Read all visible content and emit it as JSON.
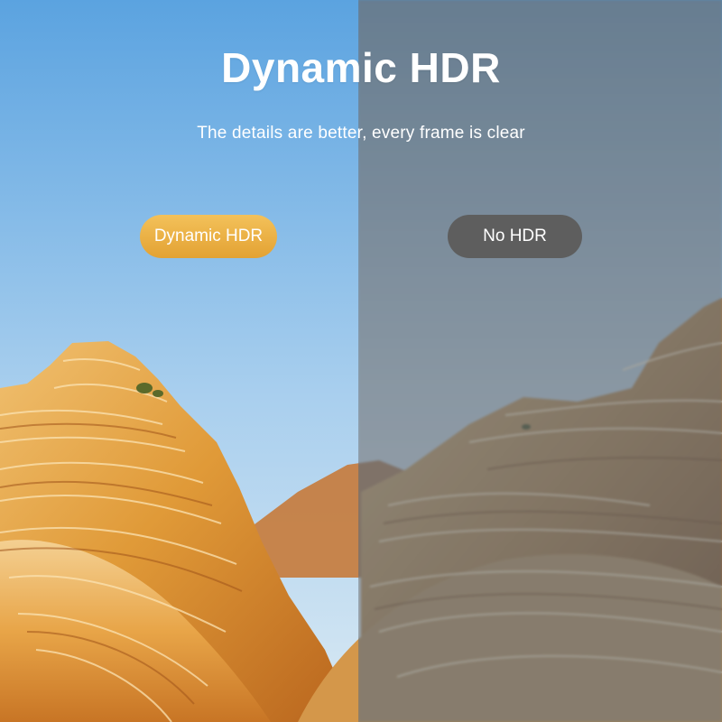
{
  "headline": "Dynamic HDR",
  "subheadline": "The details are better, every frame is clear",
  "labels": {
    "left": "Dynamic HDR",
    "right": "No HDR"
  },
  "colors": {
    "sky_top": "#5fa6e2",
    "sky_bottom": "#cfe3f1",
    "rock_light": "#f2c77a",
    "rock_mid": "#dd8f2e",
    "rock_dark": "#9a4e16",
    "hdr_pill": "#eab041",
    "nohdr_pill": "#5e5e5e"
  }
}
